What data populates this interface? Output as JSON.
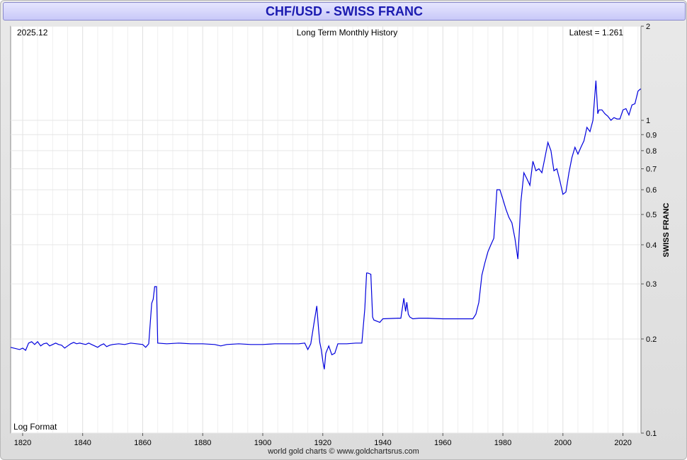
{
  "title": "CHF/USD - SWISS FRANC",
  "footer": "world gold charts © www.goldchartsrus.com",
  "chart_data": {
    "type": "line",
    "title": "CHF/USD - SWISS FRANC",
    "subtitle": "Long Term Monthly History",
    "date_label": "2025.12",
    "latest_label": "Latest = 1.261",
    "scale_note": "Log Format",
    "ylabel": "SWISS FRANC",
    "yscale": "log",
    "ylim": [
      0.1,
      2
    ],
    "xlim": [
      1816,
      2026
    ],
    "x_ticks": [
      "1820",
      "1840",
      "1860",
      "1880",
      "1900",
      "1920",
      "1940",
      "1960",
      "1980",
      "2000",
      "2020"
    ],
    "y_ticks": [
      "2",
      "1",
      "0.9",
      "0.8",
      "0.7",
      "0.6",
      "0.5",
      "0.4",
      "0.3",
      "0.2",
      "0.1"
    ],
    "grid": true,
    "line_color": "#0000dd",
    "series": [
      {
        "points": [
          [
            1816,
            0.188
          ],
          [
            1819,
            0.185
          ],
          [
            1820,
            0.187
          ],
          [
            1821,
            0.184
          ],
          [
            1822,
            0.194
          ],
          [
            1823,
            0.196
          ],
          [
            1824,
            0.192
          ],
          [
            1825,
            0.196
          ],
          [
            1826,
            0.19
          ],
          [
            1827,
            0.193
          ],
          [
            1828,
            0.194
          ],
          [
            1829,
            0.19
          ],
          [
            1830,
            0.192
          ],
          [
            1831,
            0.194
          ],
          [
            1832,
            0.192
          ],
          [
            1833,
            0.191
          ],
          [
            1834,
            0.187
          ],
          [
            1835,
            0.19
          ],
          [
            1836,
            0.193
          ],
          [
            1837,
            0.195
          ],
          [
            1838,
            0.193
          ],
          [
            1839,
            0.194
          ],
          [
            1840,
            0.193
          ],
          [
            1841,
            0.192
          ],
          [
            1842,
            0.194
          ],
          [
            1843,
            0.192
          ],
          [
            1844,
            0.19
          ],
          [
            1845,
            0.188
          ],
          [
            1846,
            0.191
          ],
          [
            1847,
            0.193
          ],
          [
            1848,
            0.189
          ],
          [
            1849,
            0.191
          ],
          [
            1850,
            0.192
          ],
          [
            1852,
            0.193
          ],
          [
            1854,
            0.192
          ],
          [
            1856,
            0.194
          ],
          [
            1858,
            0.193
          ],
          [
            1860,
            0.192
          ],
          [
            1861,
            0.188
          ],
          [
            1862,
            0.193
          ],
          [
            1863,
            0.26
          ],
          [
            1863.5,
            0.268
          ],
          [
            1864,
            0.294
          ],
          [
            1864.6,
            0.294
          ],
          [
            1865,
            0.194
          ],
          [
            1868,
            0.193
          ],
          [
            1872,
            0.194
          ],
          [
            1876,
            0.193
          ],
          [
            1880,
            0.193
          ],
          [
            1884,
            0.192
          ],
          [
            1886,
            0.19
          ],
          [
            1888,
            0.192
          ],
          [
            1892,
            0.193
          ],
          [
            1896,
            0.192
          ],
          [
            1900,
            0.192
          ],
          [
            1904,
            0.193
          ],
          [
            1908,
            0.193
          ],
          [
            1912,
            0.193
          ],
          [
            1914,
            0.194
          ],
          [
            1915,
            0.185
          ],
          [
            1916,
            0.193
          ],
          [
            1917,
            0.222
          ],
          [
            1918,
            0.255
          ],
          [
            1918.6,
            0.215
          ],
          [
            1919,
            0.195
          ],
          [
            1919.5,
            0.185
          ],
          [
            1920,
            0.17
          ],
          [
            1920.5,
            0.16
          ],
          [
            1921,
            0.18
          ],
          [
            1922,
            0.19
          ],
          [
            1923,
            0.178
          ],
          [
            1924,
            0.18
          ],
          [
            1925,
            0.193
          ],
          [
            1928,
            0.193
          ],
          [
            1931,
            0.194
          ],
          [
            1933,
            0.194
          ],
          [
            1934,
            0.25
          ],
          [
            1934.6,
            0.325
          ],
          [
            1935,
            0.325
          ],
          [
            1936,
            0.322
          ],
          [
            1936.6,
            0.235
          ],
          [
            1937,
            0.23
          ],
          [
            1939,
            0.226
          ],
          [
            1940,
            0.232
          ],
          [
            1945,
            0.233
          ],
          [
            1946,
            0.233
          ],
          [
            1947,
            0.27
          ],
          [
            1947.6,
            0.245
          ],
          [
            1948,
            0.262
          ],
          [
            1948.5,
            0.24
          ],
          [
            1949,
            0.235
          ],
          [
            1950,
            0.232
          ],
          [
            1952,
            0.233
          ],
          [
            1955,
            0.233
          ],
          [
            1960,
            0.232
          ],
          [
            1965,
            0.232
          ],
          [
            1970,
            0.232
          ],
          [
            1971,
            0.24
          ],
          [
            1972,
            0.262
          ],
          [
            1973,
            0.32
          ],
          [
            1974,
            0.35
          ],
          [
            1975,
            0.38
          ],
          [
            1976,
            0.4
          ],
          [
            1977,
            0.42
          ],
          [
            1978,
            0.6
          ],
          [
            1979,
            0.6
          ],
          [
            1980,
            0.56
          ],
          [
            1981,
            0.52
          ],
          [
            1982,
            0.49
          ],
          [
            1983,
            0.47
          ],
          [
            1984,
            0.42
          ],
          [
            1985,
            0.36
          ],
          [
            1986,
            0.55
          ],
          [
            1987,
            0.68
          ],
          [
            1988,
            0.65
          ],
          [
            1989,
            0.62
          ],
          [
            1990,
            0.74
          ],
          [
            1991,
            0.69
          ],
          [
            1992,
            0.7
          ],
          [
            1993,
            0.68
          ],
          [
            1994,
            0.76
          ],
          [
            1995,
            0.85
          ],
          [
            1996,
            0.8
          ],
          [
            1997,
            0.69
          ],
          [
            1998,
            0.7
          ],
          [
            1999,
            0.64
          ],
          [
            2000,
            0.58
          ],
          [
            2001,
            0.59
          ],
          [
            2002,
            0.68
          ],
          [
            2003,
            0.76
          ],
          [
            2004,
            0.82
          ],
          [
            2005,
            0.78
          ],
          [
            2006,
            0.82
          ],
          [
            2007,
            0.86
          ],
          [
            2008,
            0.95
          ],
          [
            2009,
            0.92
          ],
          [
            2010,
            1.0
          ],
          [
            2011,
            1.34
          ],
          [
            2011.6,
            1.05
          ],
          [
            2012,
            1.08
          ],
          [
            2013,
            1.08
          ],
          [
            2014,
            1.05
          ],
          [
            2015,
            1.03
          ],
          [
            2016,
            1.0
          ],
          [
            2017,
            1.02
          ],
          [
            2018,
            1.01
          ],
          [
            2019,
            1.01
          ],
          [
            2020,
            1.08
          ],
          [
            2021,
            1.09
          ],
          [
            2022,
            1.04
          ],
          [
            2023,
            1.12
          ],
          [
            2024,
            1.13
          ],
          [
            2025,
            1.24
          ],
          [
            2025.9,
            1.261
          ]
        ]
      }
    ]
  }
}
